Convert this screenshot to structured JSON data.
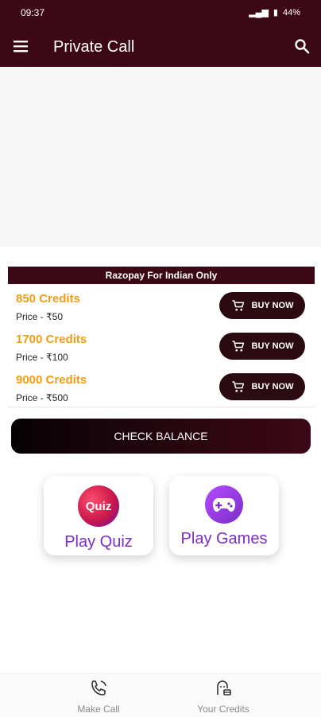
{
  "status": {
    "time": "09:37",
    "signal": "ᵞᵒᴸᵀᴱ",
    "battery": "44%"
  },
  "appbar": {
    "title": "Private Call",
    "menu_icon": "menu-icon",
    "search_icon": "search-icon"
  },
  "razorpay": {
    "banner": "Razopay For Indian Only"
  },
  "offers": [
    {
      "credits": "850 Credits",
      "price": "Price - ₹50",
      "button": "BUY NOW"
    },
    {
      "credits": "1700 Credits",
      "price": "Price - ₹100",
      "button": "BUY NOW"
    },
    {
      "credits": "9000 Credits",
      "price": "Price - ₹500",
      "button": "BUY NOW"
    }
  ],
  "check_balance": "CHECK BALANCE",
  "cards": {
    "quiz": {
      "label": "Play Quiz",
      "icon_text": "Quiz"
    },
    "games": {
      "label": "Play Games"
    }
  },
  "bottom_nav": [
    {
      "label": "Make Call",
      "icon": "phone-icon"
    },
    {
      "label": "Your Credits",
      "icon": "credits-icon"
    }
  ],
  "colors": {
    "primary": "#3d0816",
    "accent": "#f39c12",
    "purple": "#7a2ec7"
  }
}
